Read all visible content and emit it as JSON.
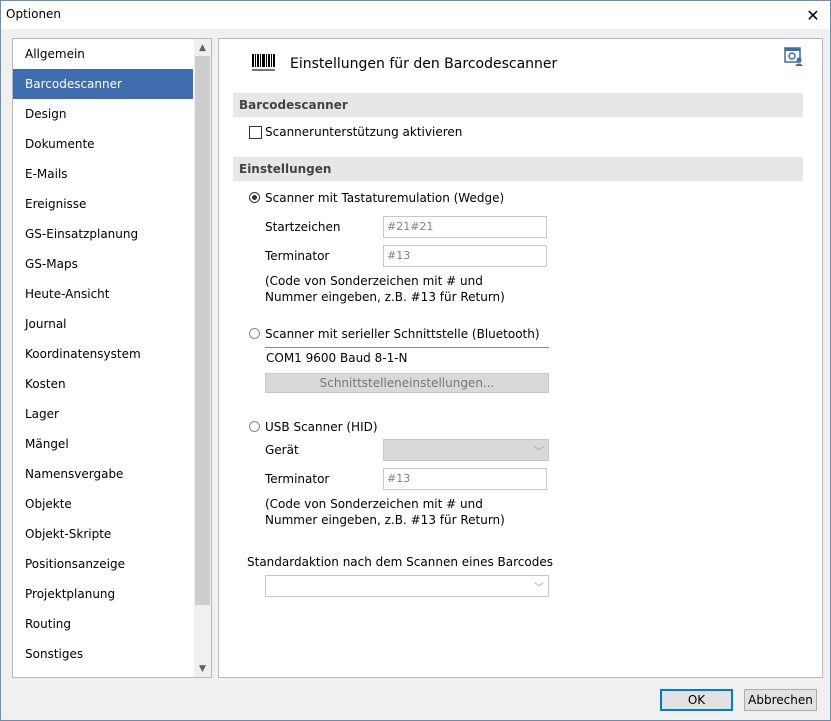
{
  "window": {
    "title": "Optionen"
  },
  "sidebar": {
    "items": [
      {
        "label": "Allgemein"
      },
      {
        "label": "Barcodescanner"
      },
      {
        "label": "Design"
      },
      {
        "label": "Dokumente"
      },
      {
        "label": "E-Mails"
      },
      {
        "label": "Ereignisse"
      },
      {
        "label": "GS-Einsatzplanung"
      },
      {
        "label": "GS-Maps"
      },
      {
        "label": "Heute-Ansicht"
      },
      {
        "label": "Journal"
      },
      {
        "label": "Koordinatensystem"
      },
      {
        "label": "Kosten"
      },
      {
        "label": "Lager"
      },
      {
        "label": "Mängel"
      },
      {
        "label": "Namensvergabe"
      },
      {
        "label": "Objekte"
      },
      {
        "label": "Objekt-Skripte"
      },
      {
        "label": "Positionsanzeige"
      },
      {
        "label": "Projektplanung"
      },
      {
        "label": "Routing"
      },
      {
        "label": "Sonstiges"
      }
    ],
    "selected": "Barcodescanner"
  },
  "panel": {
    "title": "Einstellungen für den Barcodescanner",
    "section_barcodescanner": "Barcodescanner",
    "enable_label": "Scannerunterstützung aktivieren",
    "section_settings": "Einstellungen",
    "wedge": {
      "label": "Scanner mit Tastaturemulation (Wedge)",
      "start_label": "Startzeichen",
      "start_value": "#21#21",
      "term_label": "Terminator",
      "term_value": "#13",
      "note": "(Code von Sonderzeichen mit # und Nummer eingeben, z.B. #13 für Return)"
    },
    "serial": {
      "label": "Scanner mit serieller Schnittstelle (Bluetooth)",
      "com_value": "COM1 9600 Baud 8-1-N",
      "settings_button": "Schnittstelleneinstellungen..."
    },
    "usb": {
      "label": "USB Scanner (HID)",
      "device_label": "Gerät",
      "device_value": "",
      "term_label": "Terminator",
      "term_value": "#13",
      "note": "(Code von Sonderzeichen mit # und Nummer eingeben, z.B. #13 für Return)"
    },
    "default_action_label": "Standardaktion nach dem Scannen eines Barcodes",
    "default_action_value": ""
  },
  "footer": {
    "ok": "OK",
    "cancel": "Abbrechen"
  }
}
